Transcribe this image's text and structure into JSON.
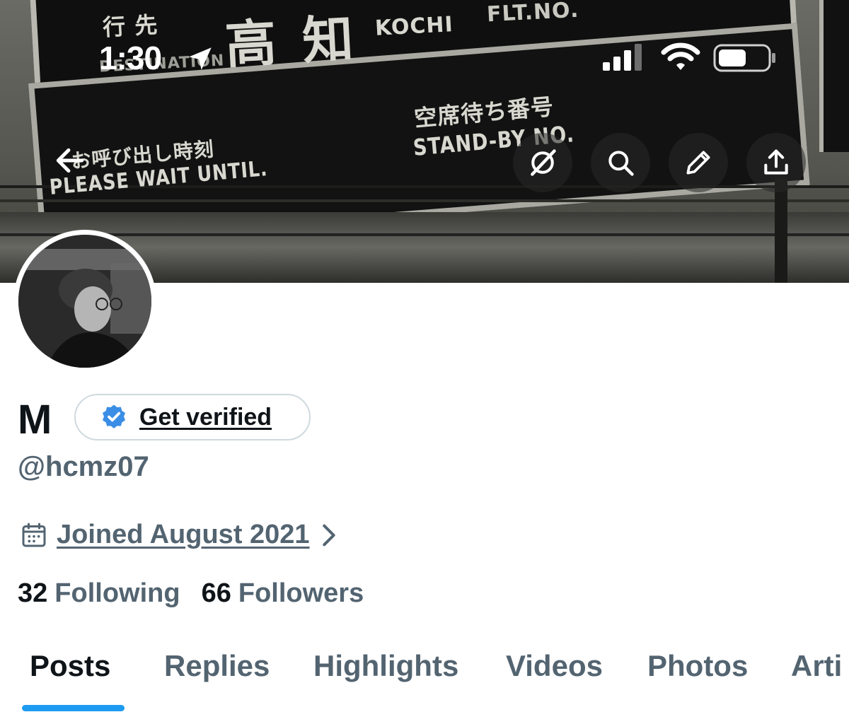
{
  "status_bar": {
    "time": "1:30",
    "icons": [
      "location-arrow-icon",
      "cellular-signal-icon",
      "wifi-icon",
      "battery-icon"
    ]
  },
  "banner": {
    "sign_texts": {
      "destination_jp": "行 先",
      "destination_label": "DESTINATION",
      "city_jp": "高 知",
      "city_en": "KOCHI",
      "flight_label": "FLT.NO.",
      "wait_jp": "お呼び出し時刻",
      "wait_en": "PLEASE WAIT UNTIL.",
      "standby_jp": "空席待ち番号",
      "standby_en": "STAND-BY NO."
    },
    "actions": [
      "back-arrow-icon",
      "grok-icon",
      "search-icon",
      "edit-icon",
      "share-icon"
    ]
  },
  "profile": {
    "display_name": "M",
    "verify_label": "Get verified",
    "handle": "@hcmz07",
    "joined": "Joined August 2021",
    "following_count": "32",
    "following_label": "Following",
    "followers_count": "66",
    "followers_label": "Followers"
  },
  "tabs": [
    {
      "label": "Posts",
      "active": true
    },
    {
      "label": "Replies",
      "active": false
    },
    {
      "label": "Highlights",
      "active": false
    },
    {
      "label": "Videos",
      "active": false
    },
    {
      "label": "Photos",
      "active": false
    },
    {
      "label": "Arti",
      "active": false
    }
  ],
  "colors": {
    "text_primary": "#0f1419",
    "text_secondary": "#536471",
    "accent": "#1d9bf0",
    "verified_badge": "#3a8ee6"
  }
}
